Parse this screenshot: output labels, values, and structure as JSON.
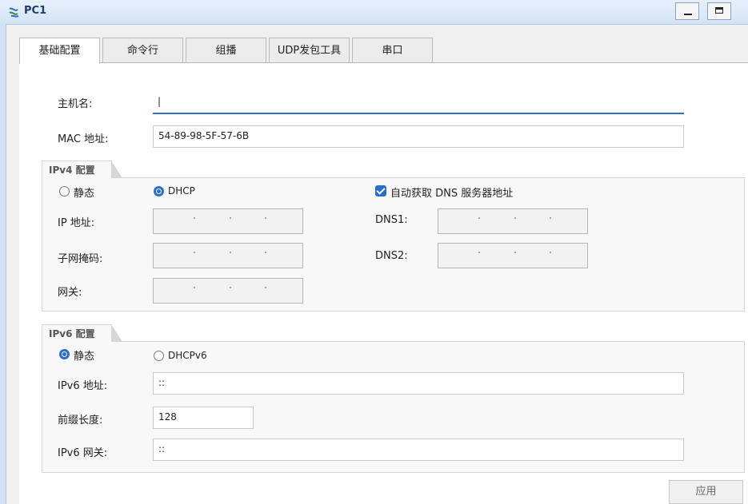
{
  "window": {
    "title": "PC1"
  },
  "tabs": [
    {
      "label": "基础配置",
      "active": true
    },
    {
      "label": "命令行",
      "active": false
    },
    {
      "label": "组播",
      "active": false
    },
    {
      "label": "UDP发包工具",
      "active": false
    },
    {
      "label": "串口",
      "active": false
    }
  ],
  "basic": {
    "hostname_label": "主机名:",
    "hostname_value": "|",
    "mac_label": "MAC 地址:",
    "mac_value": "54-89-98-5F-57-6B"
  },
  "ipv4": {
    "section_title": "IPv4 配置",
    "static_label": "静态",
    "dhcp_label": "DHCP",
    "mode": "DHCP",
    "auto_dns_label": "自动获取 DNS 服务器地址",
    "auto_dns_checked": true,
    "ip_label": "IP 地址:",
    "mask_label": "子网掩码:",
    "gateway_label": "网关:",
    "dns1_label": "DNS1:",
    "dns2_label": "DNS2:"
  },
  "ipv6": {
    "section_title": "IPv6 配置",
    "static_label": "静态",
    "dhcp_label": "DHCPv6",
    "mode": "静态",
    "address_label": "IPv6 地址:",
    "address_value": "::",
    "prefix_label": "前缀长度:",
    "prefix_value": "128",
    "gateway_label": "IPv6 网关:",
    "gateway_value": "::"
  },
  "actions": {
    "apply_label": "应用"
  },
  "colors": {
    "accent": "#2b6cc4",
    "titlebar": "#d3e3f6"
  }
}
